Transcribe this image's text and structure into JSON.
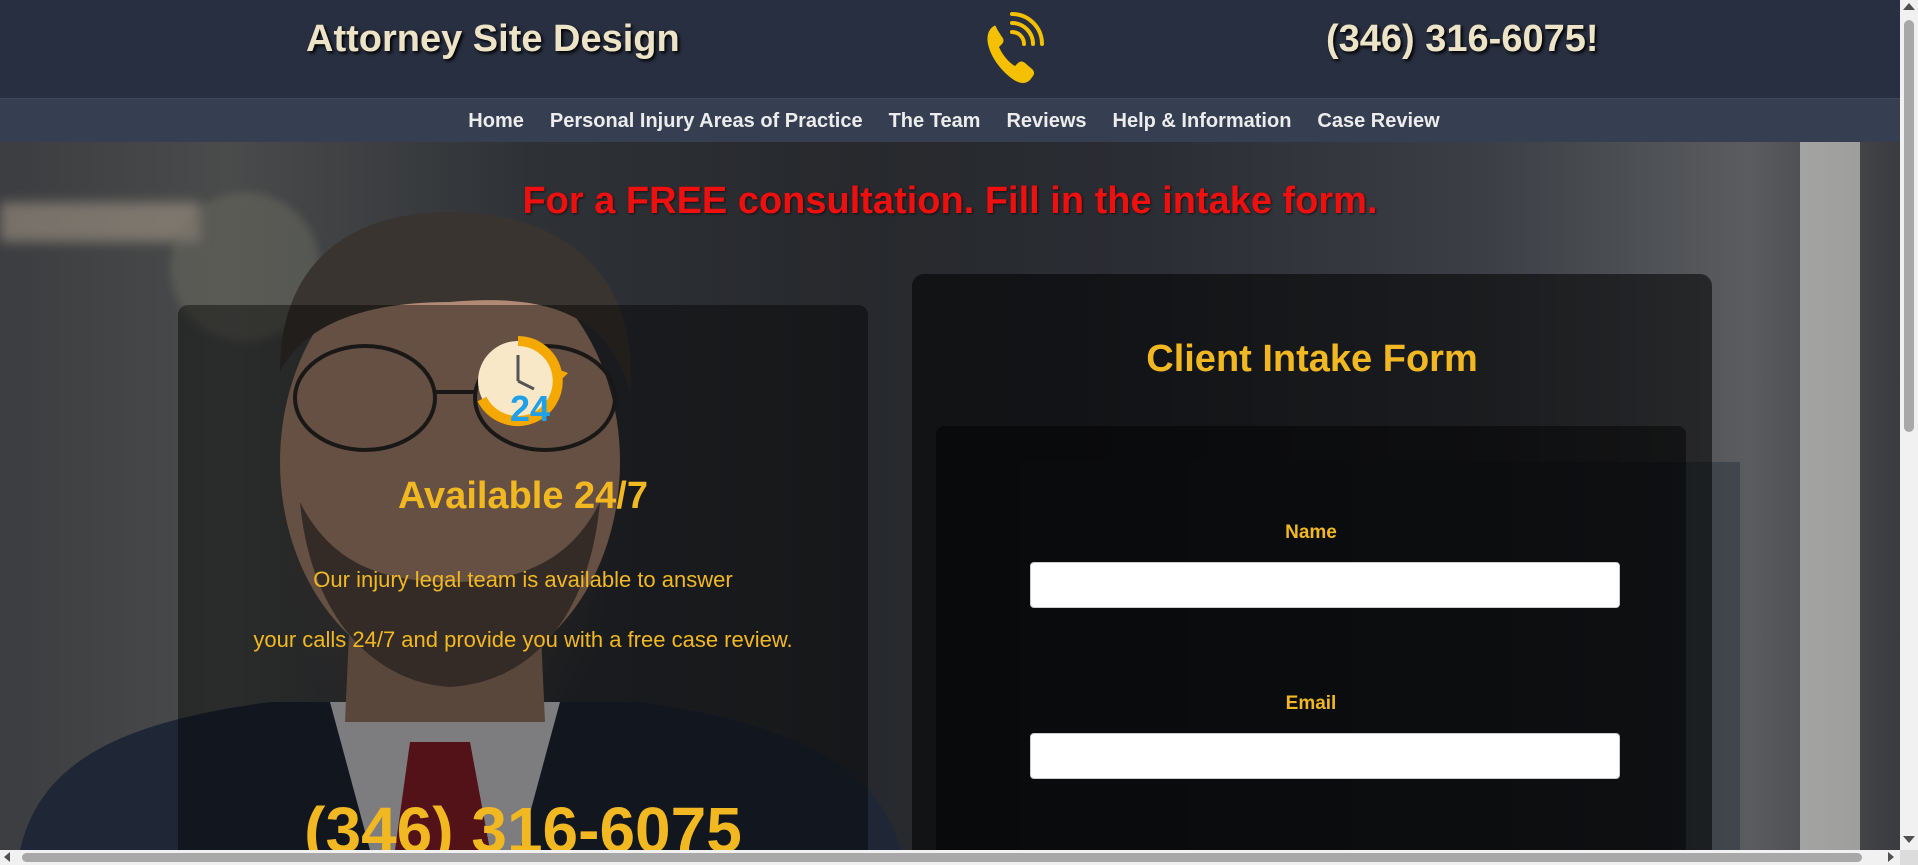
{
  "header": {
    "brand": "Attorney Site Design",
    "phone_icon": "phone-ringing-icon",
    "phone": "(346) 316-6075!"
  },
  "nav": {
    "items": [
      {
        "label": "Home"
      },
      {
        "label": "Personal Injury Areas of Practice"
      },
      {
        "label": "The Team"
      },
      {
        "label": "Reviews"
      },
      {
        "label": "Help & Information"
      },
      {
        "label": "Case Review"
      }
    ]
  },
  "hero": {
    "headline": "For a FREE consultation. Fill in the intake form.",
    "availability": {
      "icon": "clock-24-icon",
      "title": "Available 24/7",
      "line1": "Our injury legal team is available to answer",
      "line2": "your calls 24/7 and provide you with a free case review.",
      "phone": "(346) 316-6075"
    },
    "form": {
      "title": "Client Intake Form",
      "fields": [
        {
          "label": "Name",
          "value": "",
          "placeholder": ""
        },
        {
          "label": "Email",
          "value": "",
          "placeholder": ""
        }
      ]
    }
  },
  "colors": {
    "header_bg": "#282f40",
    "nav_bg": "#363e52",
    "accent_gold": "#f2b822",
    "headline_red": "#ee0f0f",
    "brand_text": "#ede4c8"
  }
}
